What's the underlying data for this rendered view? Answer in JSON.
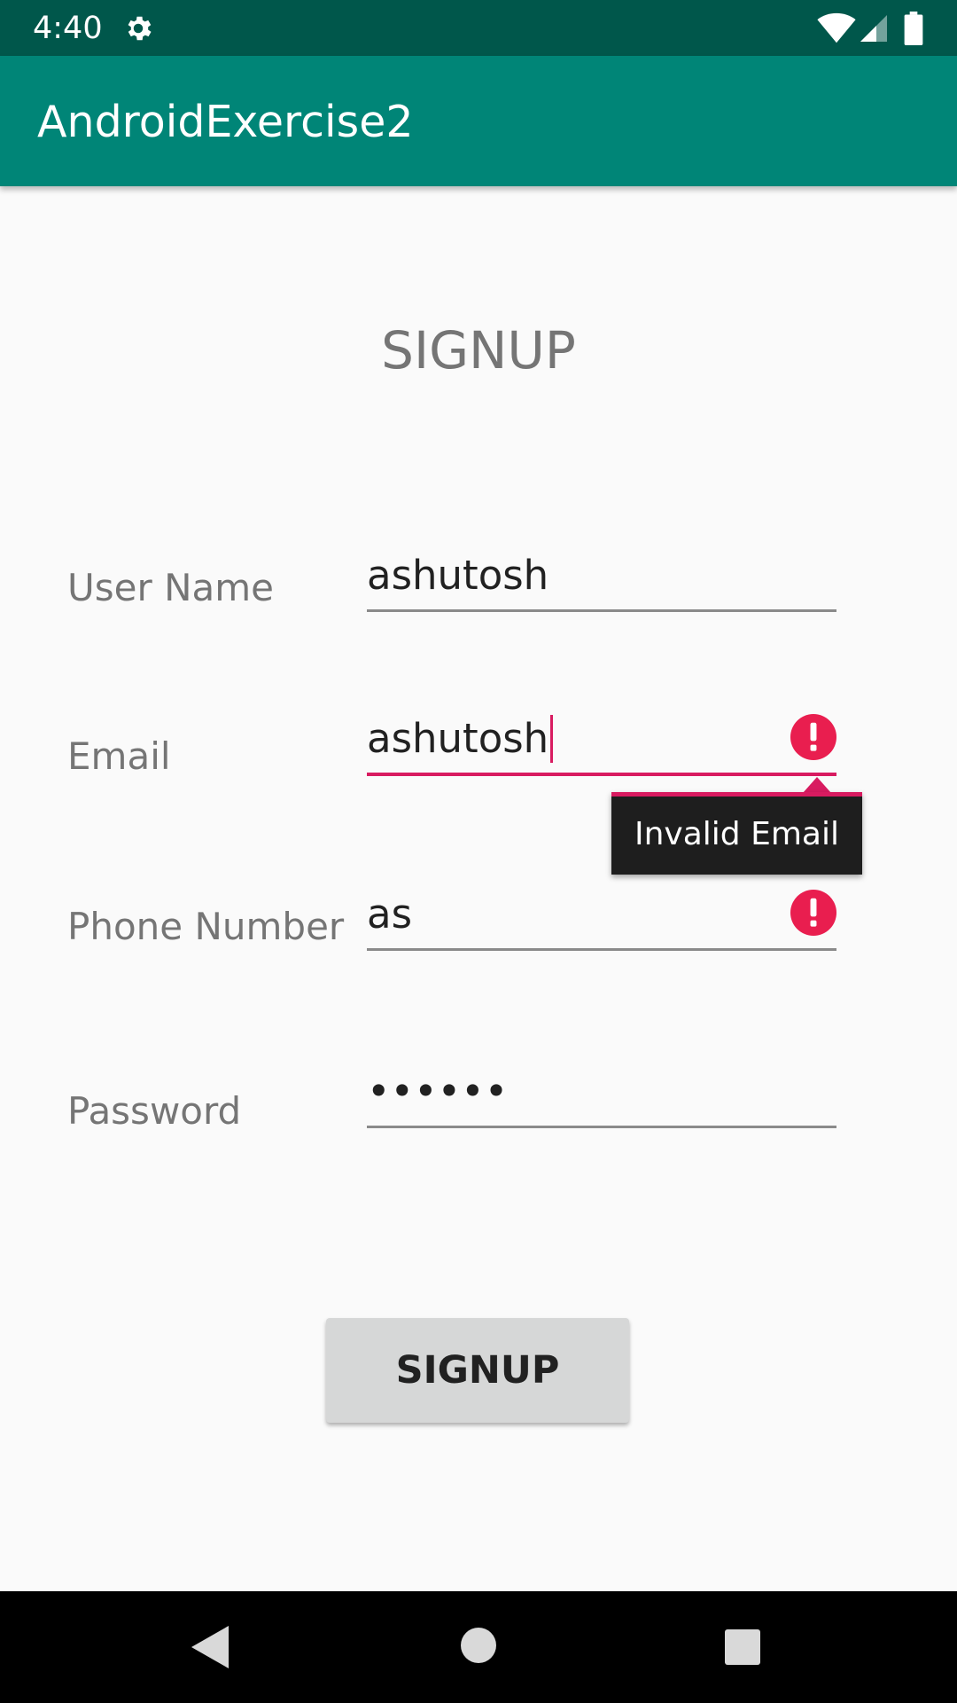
{
  "status_bar": {
    "time": "4:40",
    "icons": [
      "gear-icon",
      "wifi-icon",
      "cell-signal-icon",
      "battery-icon"
    ]
  },
  "app_bar": {
    "title": "AndroidExercise2",
    "color": "#008577"
  },
  "form": {
    "heading": "SIGNUP",
    "fields": {
      "username": {
        "label": "User Name",
        "value": "ashutosh"
      },
      "email": {
        "label": "Email",
        "value": "ashutosh",
        "error": "Invalid Email"
      },
      "phone": {
        "label": "Phone Number",
        "value": "as"
      },
      "password": {
        "label": "Password",
        "value": "••••••"
      }
    },
    "submit_label": "SIGNUP"
  },
  "colors": {
    "status_bar": "#00574b",
    "accent": "#d81b60",
    "error_icon": "#e91e4f",
    "background": "#fafafa"
  },
  "nav_bar": {
    "icons": [
      "back-icon",
      "home-icon",
      "recents-icon"
    ]
  }
}
